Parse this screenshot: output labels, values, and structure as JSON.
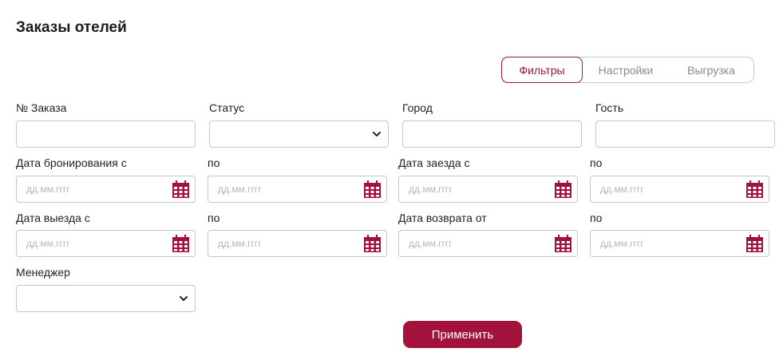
{
  "header": {
    "title": "Заказы отелей"
  },
  "tabs": [
    {
      "label": "Фильтры",
      "active": true
    },
    {
      "label": "Настройки",
      "active": false
    },
    {
      "label": "Выгрузка",
      "active": false
    }
  ],
  "filters": {
    "order_number": {
      "label": "№ Заказа",
      "value": ""
    },
    "status": {
      "label": "Статус",
      "selected": ""
    },
    "city": {
      "label": "Город",
      "value": ""
    },
    "guest": {
      "label": "Гость",
      "value": ""
    },
    "booking_date_from": {
      "label": "Дата бронирования с",
      "placeholder": "дд.мм.гггг"
    },
    "booking_date_to": {
      "label": "по",
      "placeholder": "дд.мм.гггг"
    },
    "checkin_date_from": {
      "label": "Дата заезда с",
      "placeholder": "дд.мм.гггг"
    },
    "checkin_date_to": {
      "label": "по",
      "placeholder": "дд.мм.гггг"
    },
    "checkout_date_from": {
      "label": "Дата выезда с",
      "placeholder": "дд.мм.гггг"
    },
    "checkout_date_to": {
      "label": "по",
      "placeholder": "дд.мм.гггг"
    },
    "return_date_from": {
      "label": "Дата возврата от",
      "placeholder": "дд.мм.гггг"
    },
    "return_date_to": {
      "label": "по",
      "placeholder": "дд.мм.гггг"
    },
    "manager": {
      "label": "Менеджер",
      "selected": ""
    }
  },
  "actions": {
    "apply_label": "Применить"
  },
  "colors": {
    "accent": "#a3123b",
    "border": "#c6c6c6",
    "placeholder": "#b7b7b7"
  },
  "icons": {
    "date_picker": "calendar-icon",
    "dropdown": "chevron-down-icon"
  }
}
